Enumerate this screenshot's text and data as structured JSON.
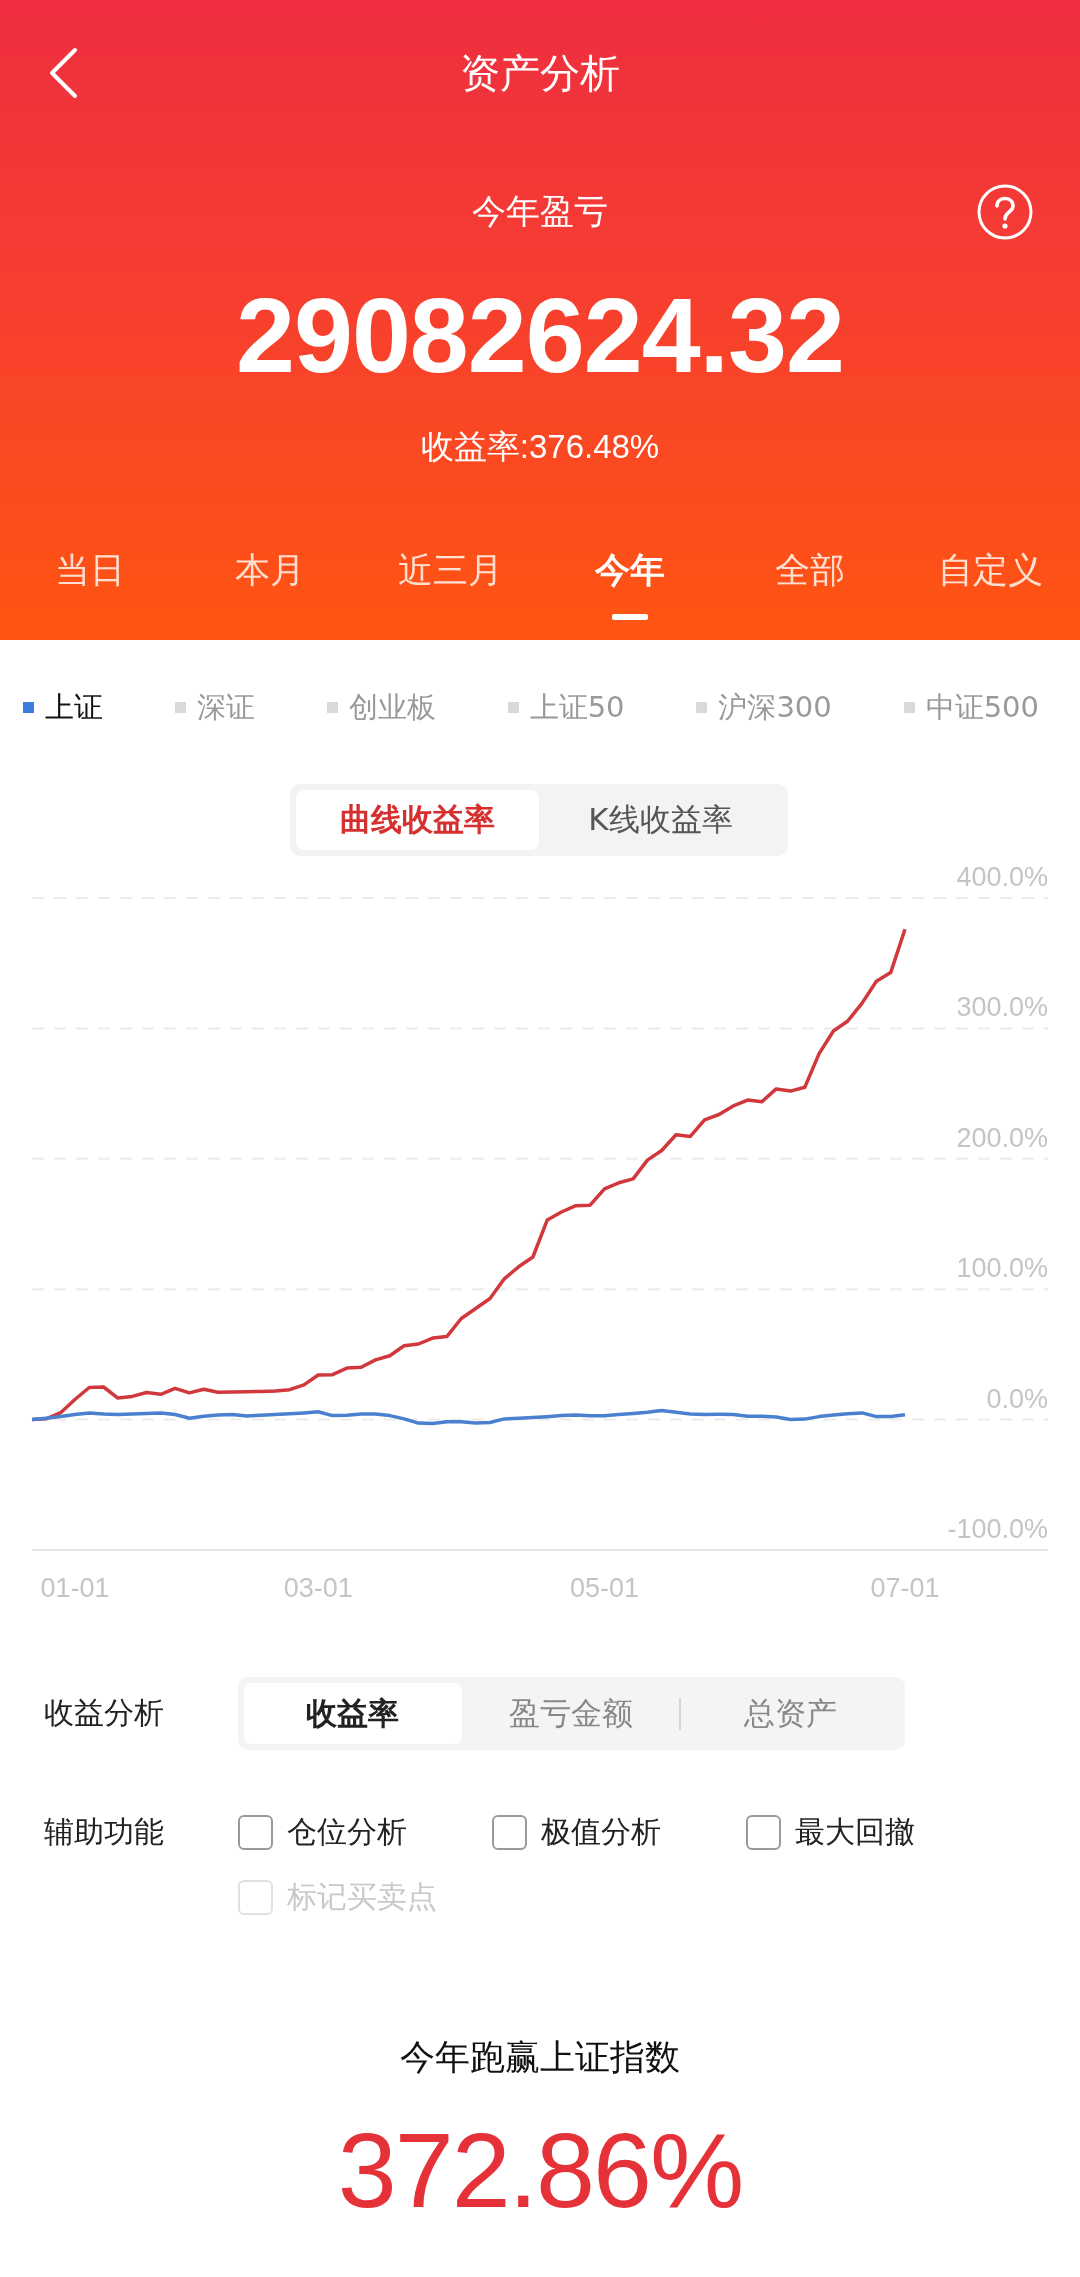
{
  "nav": {
    "title": "资产分析"
  },
  "summary": {
    "title": "今年盈亏",
    "amount": "29082624.32",
    "rate": "收益率:376.48%"
  },
  "period_tabs": [
    {
      "label": "当日",
      "selected": false
    },
    {
      "label": "本月",
      "selected": false
    },
    {
      "label": "近三月",
      "selected": false
    },
    {
      "label": "今年",
      "selected": true
    },
    {
      "label": "全部",
      "selected": false
    },
    {
      "label": "自定义",
      "selected": false
    }
  ],
  "index_legend": [
    {
      "label": "上证",
      "selected": true
    },
    {
      "label": "深证",
      "selected": false
    },
    {
      "label": "创业板",
      "selected": false
    },
    {
      "label": "上证50",
      "selected": false
    },
    {
      "label": "沪深300",
      "selected": false
    },
    {
      "label": "中证500",
      "selected": false
    }
  ],
  "chart_mode": [
    {
      "label": "曲线收益率",
      "selected": true
    },
    {
      "label": "K线收益率",
      "selected": false
    }
  ],
  "chart": {
    "chart_data": {
      "type": "line",
      "grid": true,
      "categories": [
        null,
        null,
        null,
        "01-01",
        null,
        null,
        null,
        null,
        null,
        null,
        null,
        null,
        null,
        null,
        null,
        null,
        null,
        null,
        null,
        null,
        "03-01",
        null,
        null,
        null,
        null,
        null,
        null,
        null,
        null,
        null,
        null,
        null,
        null,
        null,
        null,
        null,
        null,
        null,
        null,
        null,
        "05-01",
        null,
        null,
        null,
        null,
        null,
        null,
        null,
        null,
        null,
        null,
        null,
        null,
        null,
        null,
        null,
        null,
        null,
        null,
        null,
        null,
        "07-01"
      ],
      "series": [
        {
          "color": "#d0383c",
          "values": [
            0,
            0.6,
            5.3,
            15.4,
            24.6,
            25,
            16.5,
            17.8,
            20.8,
            19.4,
            24,
            20.5,
            23.3,
            21,
            21.1,
            21.3,
            21.6,
            22,
            22.9,
            26.6,
            34.2,
            34.4,
            39.5,
            40.2,
            45.8,
            48.9,
            56.6,
            58,
            62.5,
            63.8,
            77.5,
            85.2,
            92.9,
            108,
            117.2,
            124.7,
            153,
            159.2,
            164,
            164.4,
            177,
            181.6,
            184.6,
            199,
            206.4,
            218.4,
            217.2,
            229.8,
            234,
            240.6,
            245,
            243.8,
            253.6,
            251.9,
            254.8,
            280.7,
            298,
            305.7,
            319.4,
            336.2,
            342.8,
            376
          ]
        },
        {
          "color": "#4a80cf",
          "values": [
            0,
            1.1,
            2.4,
            4,
            5.1,
            4.2,
            3.9,
            4.3,
            4.7,
            5.1,
            3.9,
            1,
            2.6,
            3.5,
            3.9,
            2.8,
            3.4,
            3.9,
            4.5,
            5.1,
            6,
            3.1,
            3.4,
            4.3,
            4.2,
            3.1,
            0.5,
            -2.7,
            -2.9,
            -1.6,
            -1.6,
            -2.6,
            -2.2,
            0.5,
            1,
            1.5,
            2.2,
            3.1,
            3.5,
            3,
            3,
            3.8,
            4.7,
            5.7,
            7,
            5.6,
            4.4,
            4,
            4.1,
            4,
            2.6,
            2.6,
            2,
            0.1,
            0.4,
            2.3,
            3.6,
            4.5,
            5.1,
            2.3,
            2.3,
            3.7
          ]
        }
      ],
      "ylim": [
        -100,
        400
      ],
      "yticks": [
        {
          "value": -100,
          "label": "-100.0%"
        },
        {
          "value": 0,
          "label": "0.0%"
        },
        {
          "value": 100,
          "label": "100.0%"
        },
        {
          "value": 200,
          "label": "200.0%"
        },
        {
          "value": 300,
          "label": "300.0%"
        },
        {
          "value": 400,
          "label": "400.0%"
        }
      ]
    }
  },
  "analysis": {
    "label": "收益分析",
    "options": [
      {
        "label": "收益率",
        "selected": true
      },
      {
        "label": "盈亏金额",
        "selected": false
      },
      {
        "label": "总资产",
        "selected": false
      }
    ]
  },
  "aux": {
    "label": "辅助功能",
    "options": [
      {
        "label": "仓位分析",
        "checked": false,
        "disabled": false
      },
      {
        "label": "极值分析",
        "checked": false,
        "disabled": false
      },
      {
        "label": "最大回撤",
        "checked": false,
        "disabled": false
      },
      {
        "label": "标记买卖点",
        "checked": false,
        "disabled": true
      }
    ]
  },
  "outperform": {
    "title": "今年跑赢上证指数",
    "value": "372.86%"
  }
}
